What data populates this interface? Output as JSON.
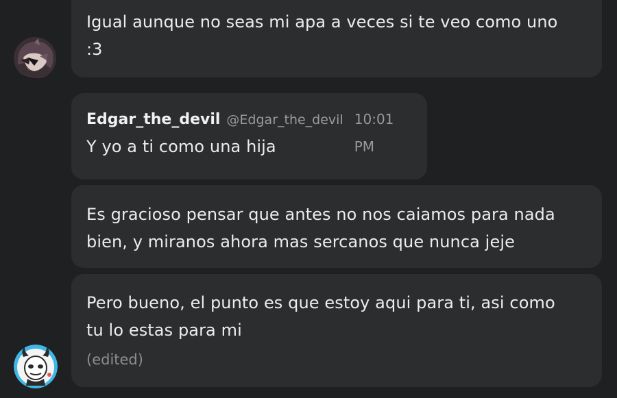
{
  "messages": [
    {
      "text": "Igual aunque no seas mi apa a veces si te veo como uno\n:3"
    },
    {
      "author": "Edgar_the_devil",
      "handle": "@Edgar_the_devil",
      "time": "10:01 PM",
      "text": "Y yo a ti como una hija"
    },
    {
      "text": "Es gracioso pensar que antes no nos caiamos para nada\nbien, y miranos ahora mas sercanos que nunca jeje"
    },
    {
      "text": "Pero bueno, el punto es que estoy aqui para ti, asi como\ntu lo estas para mi",
      "edited": "(edited)"
    }
  ],
  "colors": {
    "background": "#1f2021",
    "bubble": "#2c2d2e",
    "text": "#ececed",
    "muted": "#9a9b9d",
    "avatar2_ring": "#3fb7e6"
  },
  "avatars": [
    "anime-character-avatar",
    "cartoon-devil-avatar"
  ]
}
